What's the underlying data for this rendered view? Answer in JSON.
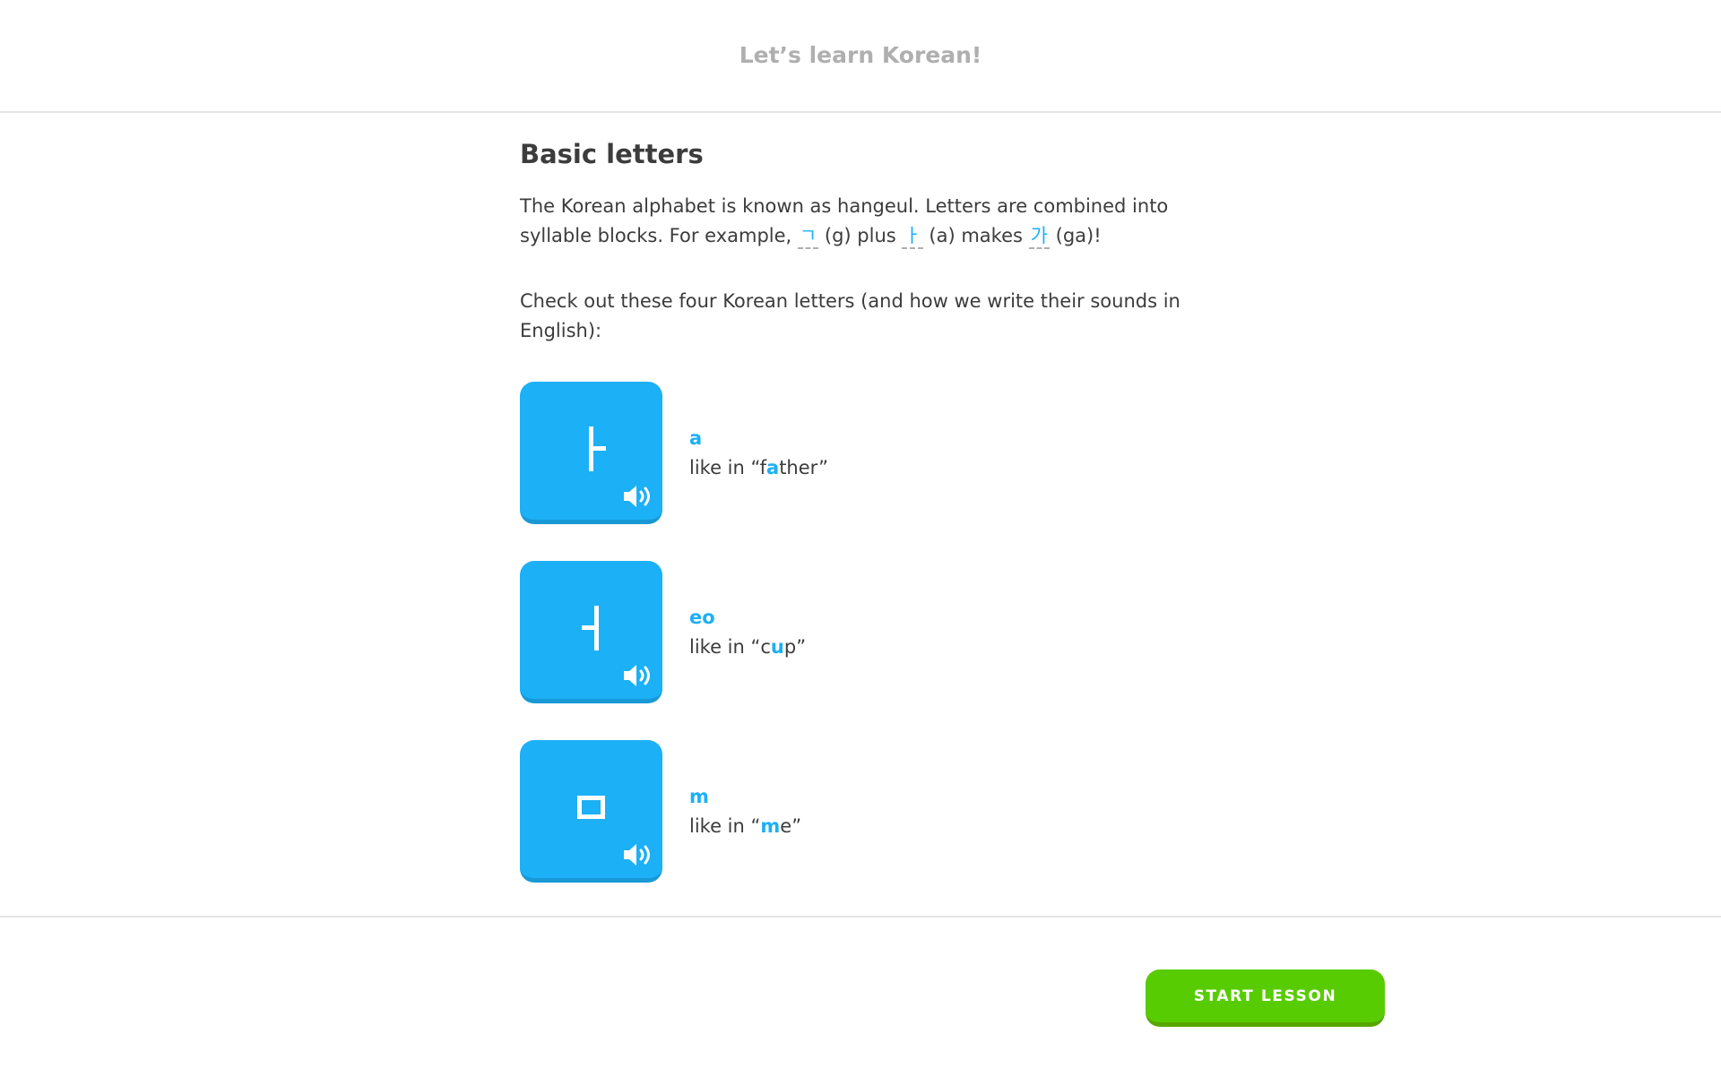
{
  "header": {
    "title": "Let’s learn Korean!"
  },
  "section": {
    "title": "Basic letters",
    "intro": {
      "text1": "The Korean alphabet is known as hangeul. Letters are combined into syllable blocks. For example, ",
      "hint1": "ㄱ",
      "text2": " (g) plus ",
      "hint2": "ㅏ",
      "text3": " (a) makes ",
      "hint3": "가",
      "text4": " (ga)!"
    },
    "subtitle": "Check out these four Korean letters (and how we write their sounds in English):"
  },
  "letters": [
    {
      "glyph": "ㅏ",
      "icon": "speaker-icon",
      "roman": "a",
      "example_prefix": "like in “f",
      "example_highlight": "a",
      "example_suffix": "ther”"
    },
    {
      "glyph": "ㅓ",
      "icon": "speaker-icon",
      "roman": "eo",
      "example_prefix": "like in “c",
      "example_highlight": "u",
      "example_suffix": "p”"
    },
    {
      "glyph": "ㅁ",
      "icon": "speaker-icon",
      "roman": "m",
      "example_prefix": "like in “",
      "example_highlight": "m",
      "example_suffix": "e”"
    }
  ],
  "footer": {
    "start_label": "START LESSON"
  },
  "colors": {
    "accent": "#1cb0f6",
    "accent_shadow": "#1899d6",
    "button_green": "#58cc02",
    "button_green_shadow": "#58a700",
    "text": "#3c3c3c",
    "muted": "#afafaf"
  }
}
